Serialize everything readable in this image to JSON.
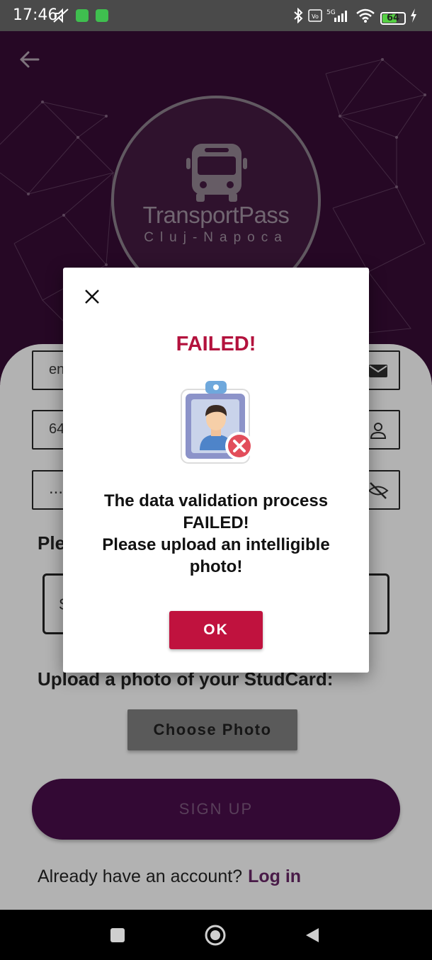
{
  "status_bar": {
    "time": "17:46",
    "battery": "64",
    "icons": [
      "mute-icon",
      "app-badge-icon",
      "app-badge-icon",
      "bluetooth-icon",
      "volte-icon",
      "signal-5g-icon",
      "wifi-icon",
      "battery-icon",
      "charging-icon"
    ]
  },
  "header": {
    "back_icon": "arrow-left-icon",
    "logo_title": "TransportPass",
    "logo_subtitle": "Cluj-Napoca"
  },
  "form": {
    "email_value": "en",
    "email_icon": "mail-icon",
    "id_value": "64",
    "id_icon": "person-icon",
    "password_value": "...",
    "password_icon": "eye-off-icon",
    "prompt_label": "Ple",
    "select_value": "S",
    "upload_label": "Upload a photo of your StudCard:",
    "choose_photo": "Choose Photo",
    "signup": "SIGN UP",
    "login_prompt": "Already have an account?",
    "login_link": "Log in"
  },
  "dialog": {
    "title": "FAILED!",
    "message_lines": [
      "The data validation process",
      "FAILED!",
      "Please upload an intelligible",
      "photo!"
    ],
    "ok": "OK",
    "close_icon": "close-icon",
    "illustration": "id-badge-error-icon"
  },
  "colors": {
    "brand_purple": "#4a0f4a",
    "error_red": "#c0123e"
  }
}
